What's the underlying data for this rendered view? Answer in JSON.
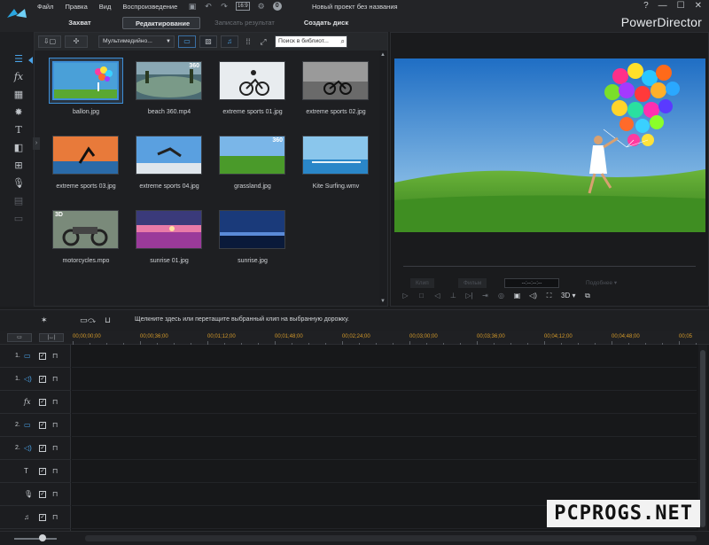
{
  "menu": [
    "Файл",
    "Правка",
    "Вид",
    "Воспроизведение"
  ],
  "toolbar": {
    "ratio": "16:9",
    "badge": "0"
  },
  "project_title": "Новый проект без названия",
  "window_controls": [
    "?",
    "—",
    "☐",
    "✕"
  ],
  "brand": "PowerDirector",
  "tabs": [
    {
      "label": "Захват",
      "state": "normal"
    },
    {
      "label": "Редактирование",
      "state": "active"
    },
    {
      "label": "Записать результат",
      "state": "disabled"
    },
    {
      "label": "Создать диск",
      "state": "normal"
    }
  ],
  "library": {
    "filter_select": "Мультимедийно...",
    "search_placeholder": "Поиск в библиот...",
    "items": [
      {
        "label": "ballon.jpg",
        "badge": "",
        "selected": true
      },
      {
        "label": "beach 360.mp4",
        "badge": "360",
        "selected": false
      },
      {
        "label": "extreme sports 01.jpg",
        "badge": "",
        "selected": false
      },
      {
        "label": "extreme sports 02.jpg",
        "badge": "",
        "selected": false
      },
      {
        "label": "extreme sports 03.jpg",
        "badge": "",
        "selected": false
      },
      {
        "label": "extreme sports 04.jpg",
        "badge": "",
        "selected": false
      },
      {
        "label": "grassland.jpg",
        "badge": "360",
        "selected": false
      },
      {
        "label": "Kite Surfing.wmv",
        "badge": "",
        "selected": false
      },
      {
        "label": "motorcycles.mpo",
        "badge": "3D",
        "selected": false
      },
      {
        "label": "sunrise 01.jpg",
        "badge": "",
        "selected": false
      },
      {
        "label": "sunrise.jpg",
        "badge": "",
        "selected": false
      }
    ]
  },
  "preview": {
    "mode_clip": "Клип",
    "mode_movie": "Фильм",
    "timecode": "--:--:--:--",
    "quality": "Подобнее ▾",
    "threed_label": "3D"
  },
  "timeline": {
    "hint": "Щелкните здесь или перетащите выбранный клип на выбранную дорожку.",
    "ruler": [
      "00;00;00;00",
      "00;00;36;00",
      "00;01;12;00",
      "00;01;48;00",
      "00;02;24;00",
      "00;03;00;00",
      "00;03;36;00",
      "00;04;12;00",
      "00;04;48;00",
      "00;05"
    ],
    "tracks": [
      {
        "num": "1.",
        "icon": "▭",
        "kind": "video"
      },
      {
        "num": "1.",
        "icon": "◁)",
        "kind": "audio"
      },
      {
        "num": "",
        "icon": "fx",
        "kind": "fx"
      },
      {
        "num": "2.",
        "icon": "▭",
        "kind": "video"
      },
      {
        "num": "2.",
        "icon": "◁)",
        "kind": "audio"
      },
      {
        "num": "",
        "icon": "T",
        "kind": "title"
      },
      {
        "num": "",
        "icon": "🎙",
        "kind": "voice"
      },
      {
        "num": "",
        "icon": "♫",
        "kind": "music"
      }
    ]
  },
  "watermark": "PCPROGS.NET"
}
